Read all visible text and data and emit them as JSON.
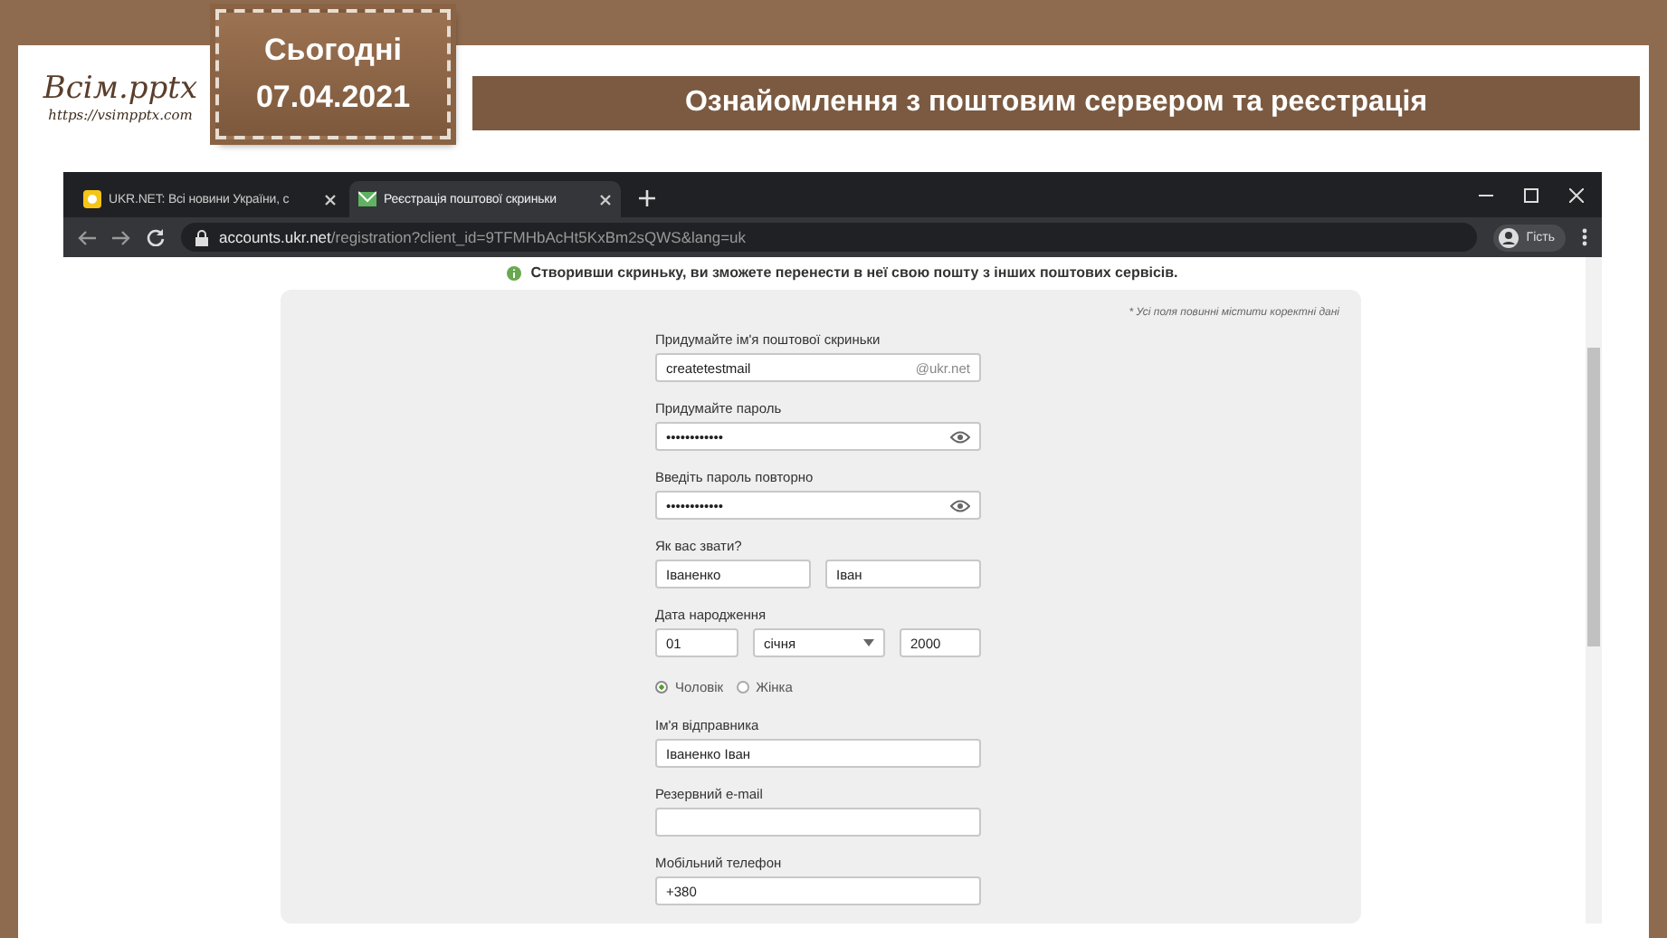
{
  "slide": {
    "logo": {
      "title": "Всім.pptx",
      "url": "https://vsimpptx.com"
    },
    "date_label": "Сьогодні",
    "date": "07.04.2021",
    "title": "Ознайомлення з поштовим сервером та реєстрація"
  },
  "browser": {
    "tabs": [
      {
        "title": "UKR.NET: Всі новини України, с",
        "selected": false
      },
      {
        "title": "Реєстрація поштової скриньки",
        "selected": true
      }
    ],
    "address": {
      "host": "accounts.ukr.net",
      "path": "/registration?client_id=9TFMHbAcHt5KxBm2sQWS&lang=uk"
    },
    "profile": "Гість",
    "notice": "Створивши скриньку, ви зможете перенести в неї свою пошту з інших поштових сервісів.",
    "form": {
      "note": "* Усі поля повинні містити коректні дані",
      "rows": [
        {
          "kind": "text",
          "label": "Придумайте ім'я поштової скриньки",
          "value": "createtestmail",
          "suffix": "@ukr.net"
        },
        {
          "kind": "password",
          "label": "Придумайте пароль",
          "value": "••••••••••••"
        },
        {
          "kind": "password",
          "label": "Введіть пароль повторно",
          "value": "••••••••••••"
        },
        {
          "kind": "pair",
          "label": "Як вас звати?",
          "values": [
            "Іваненко",
            "Іван"
          ]
        },
        {
          "kind": "date",
          "label": "Дата народження",
          "day": "01",
          "month": "січня",
          "year": "2000"
        },
        {
          "kind": "radio",
          "options": [
            {
              "label": "Чоловік",
              "selected": true
            },
            {
              "label": "Жінка",
              "selected": false
            }
          ]
        },
        {
          "kind": "text",
          "label": "Ім'я відправника",
          "value": "Іваненко Іван"
        },
        {
          "kind": "text",
          "label": "Резервний e-mail"
        },
        {
          "kind": "text",
          "label": "Мобільний телефон",
          "value": "+380"
        }
      ]
    }
  }
}
